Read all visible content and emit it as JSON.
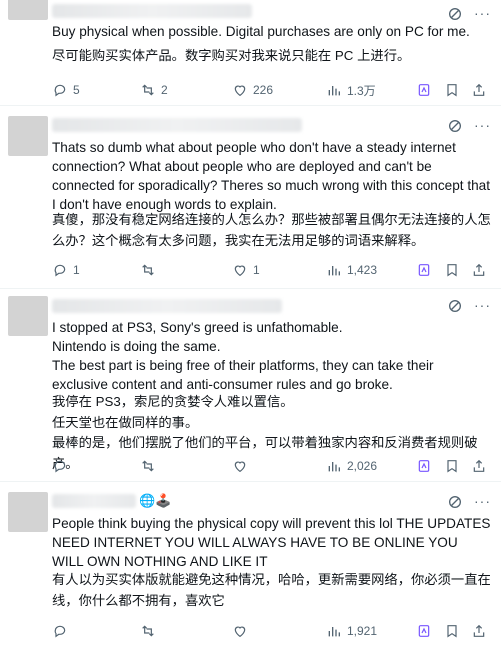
{
  "posts": [
    {
      "text": "Buy physical when possible. Digital purchases are only on PC for me.",
      "translation": "尽可能购买实体产品。数字购买对我来说只能在 PC 上进行。",
      "replies": "5",
      "reposts": "2",
      "likes": "226",
      "views": "1.3万"
    },
    {
      "text": "Thats so dumb what about people who don't have a steady internet connection? What about people who are deployed and can't be connected for sporadically? Theres so much wrong with this concept that I don't have enough words to explain.",
      "translation": "真傻，那没有稳定网络连接的人怎么办？那些被部署且偶尔无法连接的人怎么办？这个概念有太多问题，我实在无法用足够的词语来解释。",
      "replies": "1",
      "reposts": "",
      "likes": "1",
      "views": "1,423"
    },
    {
      "text": "I stopped at PS3, Sony's greed is  unfathomable.\nNintendo is doing the same.\nThe best part is being free of their platforms, they can take their exclusive content and anti-consumer rules and go broke.",
      "translation": "我停在 PS3，索尼的贪婪令人难以置信。\n任天堂也在做同样的事。\n最棒的是，他们摆脱了他们的平台，可以带着独家内容和反消费者规则破产。",
      "replies": "",
      "reposts": "",
      "likes": "",
      "views": "2,026"
    },
    {
      "text": "People think buying the physical copy will prevent this lol THE UPDATES NEED INTERNET YOU WILL ALWAYS HAVE TO BE ONLINE YOU WILL OWN NOTHING AND LIKE IT",
      "translation": "有人以为买实体版就能避免这种情况，哈哈，更新需要网络，你必须一直在线，你什么都不拥有，喜欢它",
      "replies": "",
      "reposts": "",
      "likes": "",
      "views": "1,921",
      "name_emoji": "🌐🕹️"
    }
  ],
  "colors": {
    "text": "#0f1419",
    "muted": "#536471",
    "accent": "#1d9bf0",
    "divider": "#eff3f4"
  },
  "icons": [
    "grok-icon",
    "more-icon",
    "reply-icon",
    "repost-icon",
    "like-icon",
    "views-icon",
    "bookmark-icon",
    "share-icon"
  ]
}
